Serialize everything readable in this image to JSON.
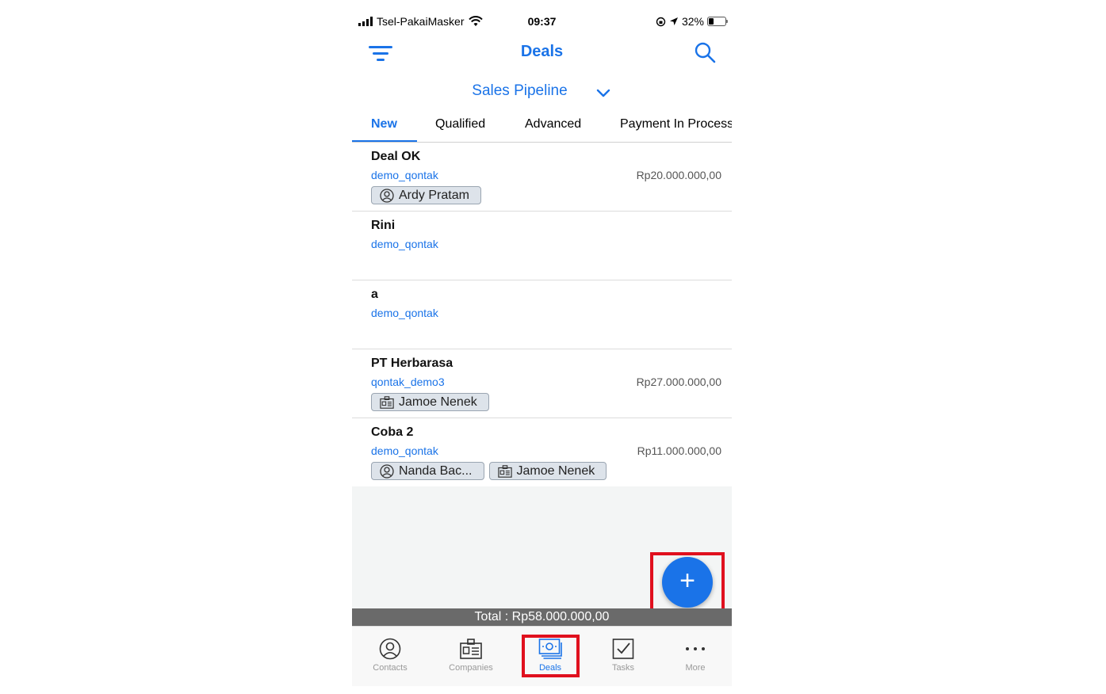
{
  "status_bar": {
    "carrier": "Tsel-PakaiMasker",
    "time": "09:37",
    "battery": "32%"
  },
  "header": {
    "title": "Deals",
    "icons": [
      "filter-icon",
      "search-icon"
    ]
  },
  "pipeline": {
    "selected": "Sales Pipeline"
  },
  "tabs": [
    {
      "label": "New",
      "active": true
    },
    {
      "label": "Qualified"
    },
    {
      "label": "Advanced"
    },
    {
      "label": "Payment In Process"
    }
  ],
  "deals": [
    {
      "name": "Deal OK",
      "owner": "demo_qontak",
      "amount": "Rp20.000.000,00",
      "chips": [
        {
          "type": "contact",
          "label": "Ardy Pratam"
        }
      ]
    },
    {
      "name": "Rini",
      "owner": "demo_qontak",
      "amount": "",
      "chips": []
    },
    {
      "name": "a",
      "owner": "demo_qontak",
      "amount": "",
      "chips": []
    },
    {
      "name": "PT Herbarasa",
      "owner": "qontak_demo3",
      "amount": "Rp27.000.000,00",
      "chips": [
        {
          "type": "company",
          "label": "Jamoe Nenek"
        }
      ]
    },
    {
      "name": "Coba 2",
      "owner": "demo_qontak",
      "amount": "Rp11.000.000,00",
      "chips": [
        {
          "type": "contact",
          "label": "Nanda Bac..."
        },
        {
          "type": "company",
          "label": "Jamoe Nenek"
        }
      ]
    }
  ],
  "fab": {
    "label": "+"
  },
  "total": "Total : Rp58.000.000,00",
  "nav": [
    {
      "label": "Contacts",
      "icon": "contact-icon"
    },
    {
      "label": "Companies",
      "icon": "company-icon"
    },
    {
      "label": "Deals",
      "icon": "deals-icon",
      "active": true
    },
    {
      "label": "Tasks",
      "icon": "tasks-icon"
    },
    {
      "label": "More",
      "icon": "more-icon"
    }
  ],
  "colors": {
    "accent": "#1a73e8",
    "highlight": "#e0101e",
    "total_bar": "#6a6a6a"
  }
}
